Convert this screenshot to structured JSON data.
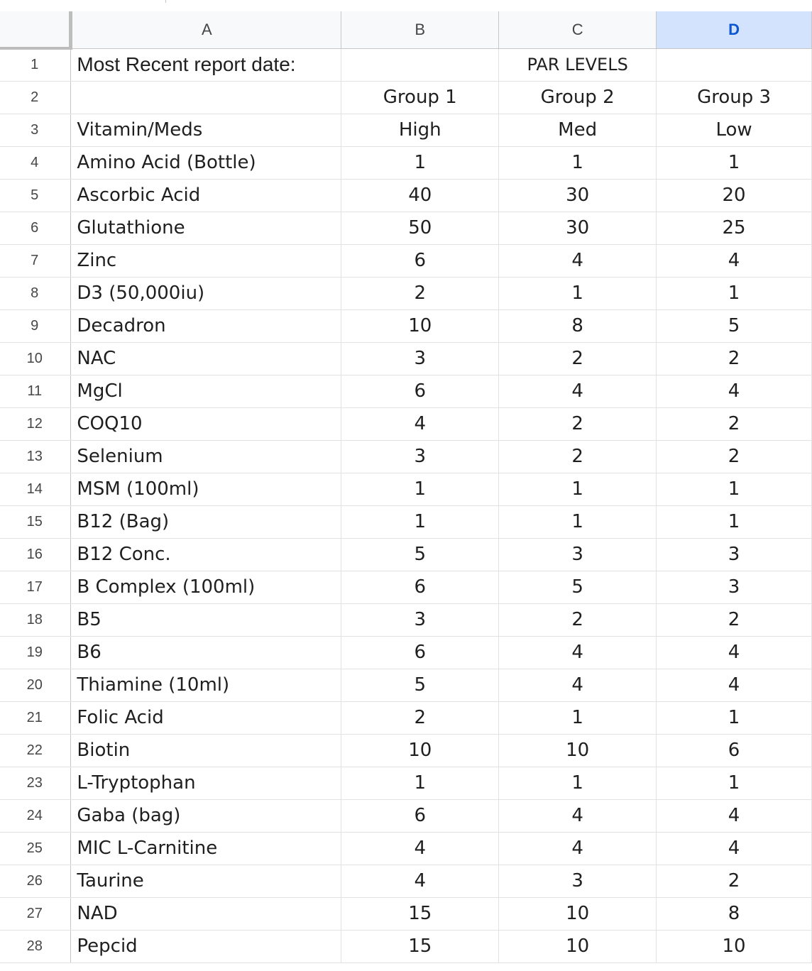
{
  "columns": [
    {
      "letter": "A"
    },
    {
      "letter": "B"
    },
    {
      "letter": "C"
    },
    {
      "letter": "D",
      "selected": true
    }
  ],
  "row1": {
    "label": "Most Recent report date:",
    "par_levels": "PAR LEVELS"
  },
  "row2": {
    "group1": "Group 1",
    "group2": "Group 2",
    "group3": "Group 3"
  },
  "row3": {
    "label": "Vitamin/Meds",
    "high": "High",
    "med": "Med",
    "low": "Low"
  },
  "rows": [
    {
      "num": "1"
    },
    {
      "num": "2"
    },
    {
      "num": "3"
    }
  ],
  "items": [
    {
      "row": "4",
      "name": "Amino Acid (Bottle)",
      "high": "1",
      "med": "1",
      "low": "1"
    },
    {
      "row": "5",
      "name": "Ascorbic Acid",
      "high": "40",
      "med": "30",
      "low": "20"
    },
    {
      "row": "6",
      "name": "Glutathione",
      "high": "50",
      "med": "30",
      "low": "25"
    },
    {
      "row": "7",
      "name": "Zinc",
      "high": "6",
      "med": "4",
      "low": "4"
    },
    {
      "row": "8",
      "name": "D3 (50,000iu)",
      "high": "2",
      "med": "1",
      "low": "1"
    },
    {
      "row": "9",
      "name": "Decadron",
      "high": "10",
      "med": "8",
      "low": "5"
    },
    {
      "row": "10",
      "name": "NAC",
      "high": "3",
      "med": "2",
      "low": "2"
    },
    {
      "row": "11",
      "name": "MgCl",
      "high": "6",
      "med": "4",
      "low": "4"
    },
    {
      "row": "12",
      "name": "COQ10",
      "high": "4",
      "med": "2",
      "low": "2"
    },
    {
      "row": "13",
      "name": "Selenium",
      "high": "3",
      "med": "2",
      "low": "2"
    },
    {
      "row": "14",
      "name": "MSM (100ml)",
      "high": "1",
      "med": "1",
      "low": "1"
    },
    {
      "row": "15",
      "name": "B12 (Bag)",
      "high": "1",
      "med": "1",
      "low": "1"
    },
    {
      "row": "16",
      "name": "B12 Conc.",
      "high": "5",
      "med": "3",
      "low": "3"
    },
    {
      "row": "17",
      "name": "B Complex (100ml)",
      "high": "6",
      "med": "5",
      "low": "3"
    },
    {
      "row": "18",
      "name": "B5",
      "high": "3",
      "med": "2",
      "low": "2"
    },
    {
      "row": "19",
      "name": "B6",
      "high": "6",
      "med": "4",
      "low": "4"
    },
    {
      "row": "20",
      "name": "Thiamine (10ml)",
      "high": "5",
      "med": "4",
      "low": "4"
    },
    {
      "row": "21",
      "name": "Folic Acid",
      "high": "2",
      "med": "1",
      "low": "1"
    },
    {
      "row": "22",
      "name": "Biotin",
      "high": "10",
      "med": "10",
      "low": "6"
    },
    {
      "row": "23",
      "name": "L-Tryptophan",
      "high": "1",
      "med": "1",
      "low": "1"
    },
    {
      "row": "24",
      "name": "Gaba (bag)",
      "high": "6",
      "med": "4",
      "low": "4"
    },
    {
      "row": "25",
      "name": "MIC L-Carnitine",
      "high": "4",
      "med": "4",
      "low": "4"
    },
    {
      "row": "26",
      "name": "Taurine",
      "high": "4",
      "med": "3",
      "low": "2"
    },
    {
      "row": "27",
      "name": "NAD",
      "high": "15",
      "med": "10",
      "low": "8"
    },
    {
      "row": "28",
      "name": "Pepcid",
      "high": "15",
      "med": "10",
      "low": "10"
    }
  ],
  "colors": {
    "selected_header_bg": "#d3e3fd",
    "selected_header_text": "#0b57d0",
    "gridline": "#e2e2e3"
  }
}
